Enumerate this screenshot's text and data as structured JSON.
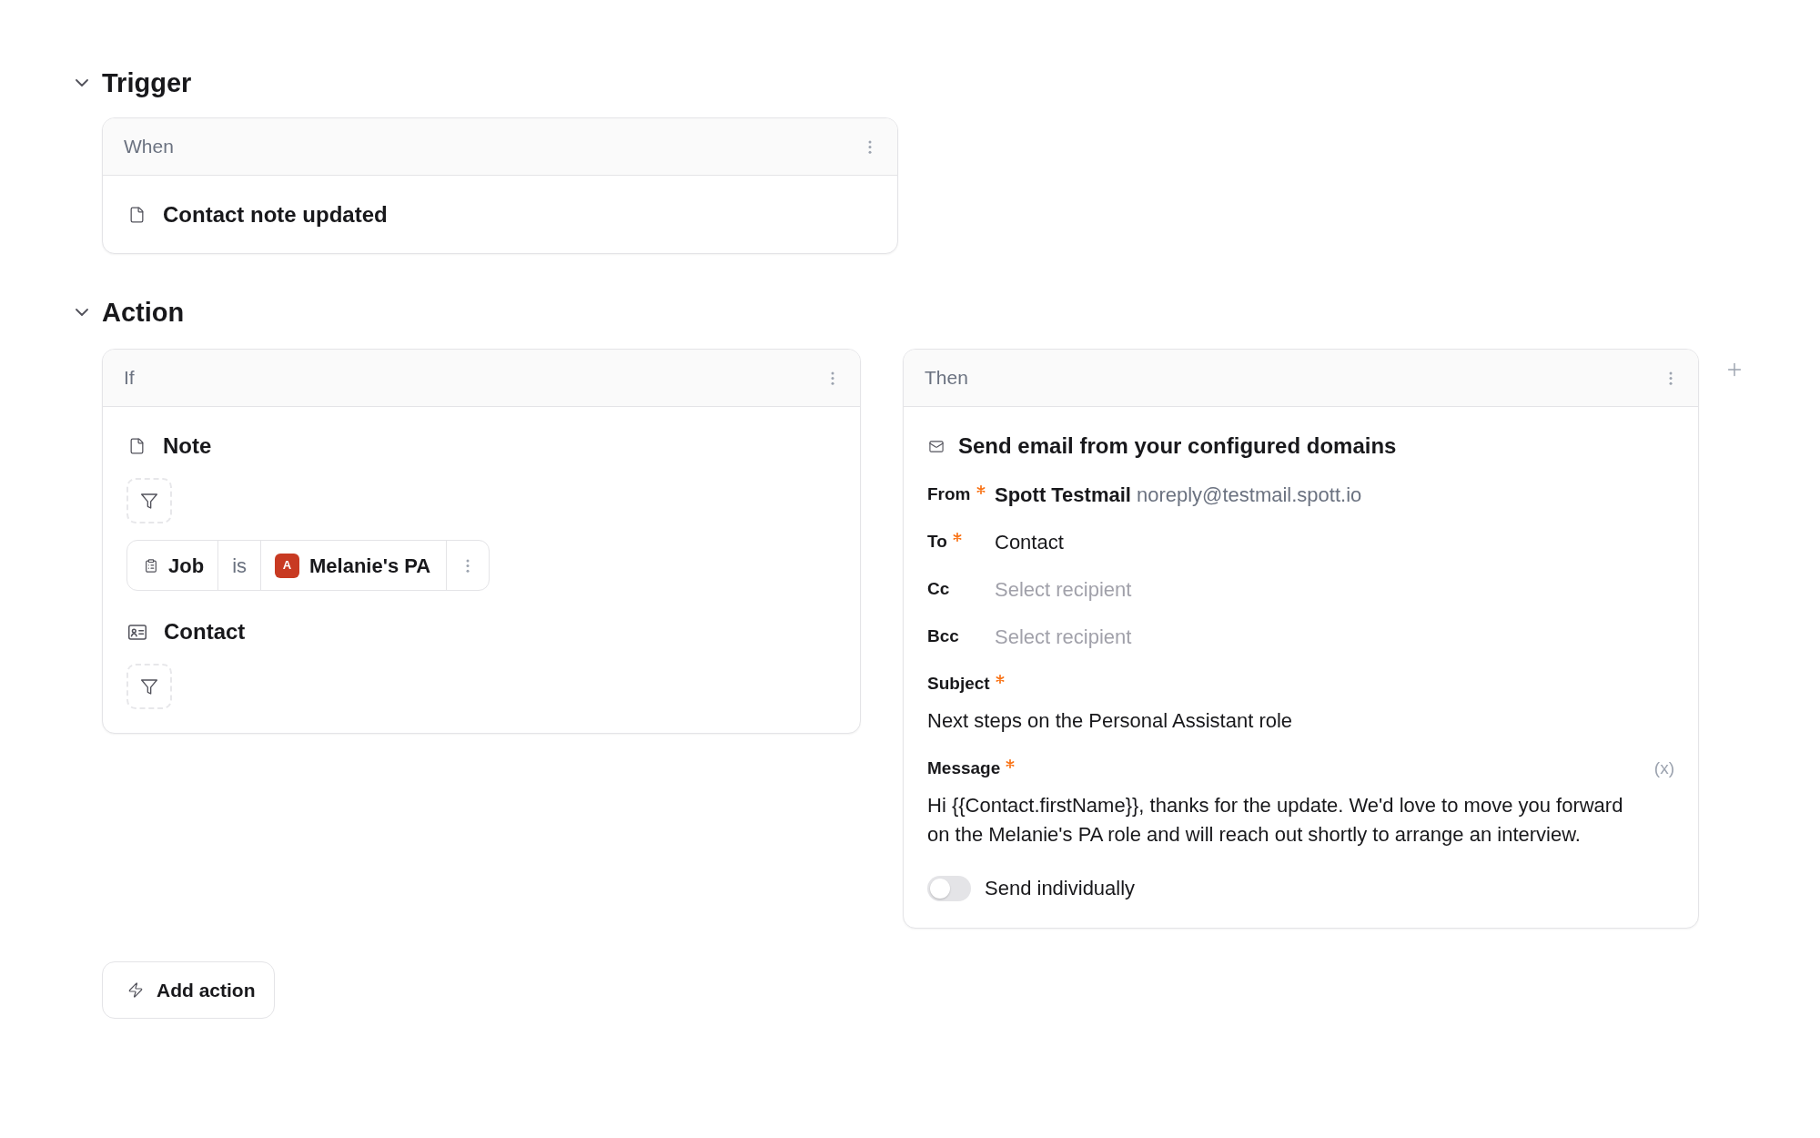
{
  "trigger": {
    "heading": "Trigger",
    "expanded": true,
    "card": {
      "header": "When",
      "event": "Contact note updated"
    }
  },
  "action": {
    "heading": "Action",
    "expanded": true,
    "if_card": {
      "header": "If",
      "groups": [
        {
          "kind": "note",
          "title": "Note",
          "conditions": [
            {
              "field": "Job",
              "operator": "is",
              "value_badge": "A",
              "value": "Melanie's PA"
            }
          ]
        },
        {
          "kind": "contact",
          "title": "Contact"
        }
      ]
    },
    "then_card": {
      "header": "Then",
      "title": "Send email from your configured domains",
      "recipients": [
        {
          "kind": "sender",
          "label": "From",
          "required": true,
          "name": "Spott Testmail",
          "address": "noreply@testmail.spott.io"
        },
        {
          "kind": "value",
          "label": "To",
          "required": true,
          "value": "Contact"
        },
        {
          "kind": "empty",
          "label": "Cc",
          "required": false,
          "placeholder": "Select recipient"
        },
        {
          "kind": "empty",
          "label": "Bcc",
          "required": false,
          "placeholder": "Select recipient"
        }
      ],
      "subject": {
        "label": "Subject",
        "required": true,
        "value": "Next steps on the Personal Assistant role"
      },
      "message": {
        "label": "Message",
        "required": true,
        "variables_button": "(x)",
        "value": "Hi {{Contact.firstName}}, thanks for the update. We'd love to move you forward on the Melanie's PA role and will reach out shortly to arrange an interview."
      },
      "send_individually": {
        "label": "Send individually",
        "on": false
      }
    }
  },
  "add_action": {
    "label": "Add action"
  }
}
